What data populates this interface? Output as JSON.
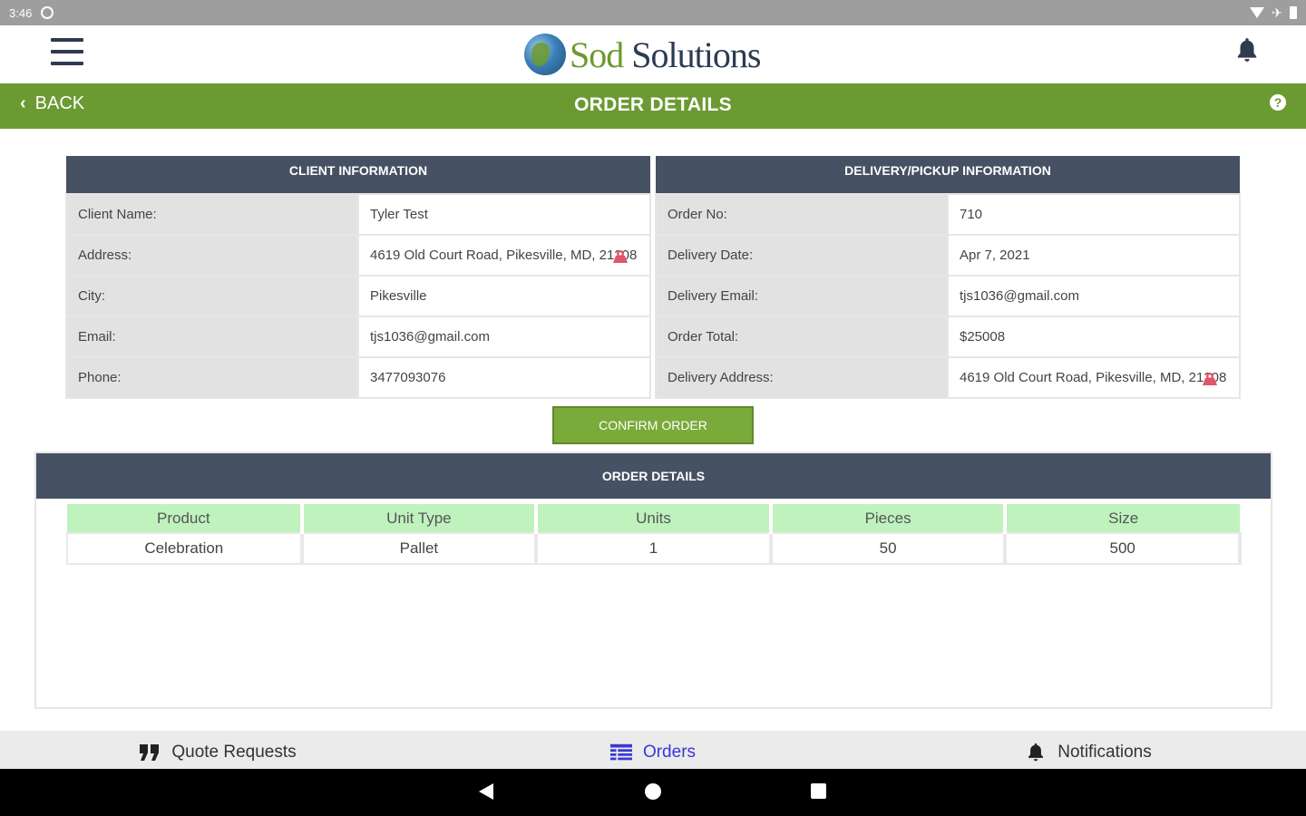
{
  "status_bar": {
    "time": "3:46"
  },
  "header": {
    "brand_part1": "Sod",
    "brand_part2": " Solutions"
  },
  "title_bar": {
    "back_label": "BACK",
    "title": "ORDER DETAILS",
    "help_glyph": "?"
  },
  "client_info": {
    "heading": "CLIENT INFORMATION",
    "rows": [
      {
        "label": "Client Name:",
        "value": "Tyler Test"
      },
      {
        "label": "Address:",
        "value": "4619 Old Court Road, Pikesville, MD, 21208"
      },
      {
        "label": "City:",
        "value": "Pikesville"
      },
      {
        "label": "Email:",
        "value": "tjs1036@gmail.com"
      },
      {
        "label": "Phone:",
        "value": "3477093076"
      }
    ]
  },
  "delivery_info": {
    "heading": "DELIVERY/PICKUP INFORMATION",
    "rows": [
      {
        "label": "Order No:",
        "value": "710"
      },
      {
        "label": "Delivery Date:",
        "value": "Apr 7, 2021"
      },
      {
        "label": "Delivery Email:",
        "value": "tjs1036@gmail.com"
      },
      {
        "label": "Order Total:",
        "value": "$25008"
      },
      {
        "label": "Delivery Address:",
        "value": "4619 Old Court Road, Pikesville, MD, 21208"
      }
    ]
  },
  "confirm_button": {
    "label": "CONFIRM ORDER"
  },
  "order_details": {
    "heading": "ORDER DETAILS",
    "columns": [
      "Product",
      "Unit Type",
      "Units",
      "Pieces",
      "Size"
    ],
    "rows": [
      [
        "Celebration",
        "Pallet",
        "1",
        "50",
        "500"
      ]
    ]
  },
  "tabs": [
    {
      "label": "Quote Requests",
      "icon": "quote-icon",
      "active": false
    },
    {
      "label": "Orders",
      "icon": "list-icon",
      "active": true
    },
    {
      "label": "Notifications",
      "icon": "bell-icon",
      "active": false
    }
  ],
  "colors": {
    "brand_green": "#6b9a33",
    "header_navy": "#465163",
    "active_tab": "#3a37d8",
    "table_header_green": "#bff2bd"
  }
}
